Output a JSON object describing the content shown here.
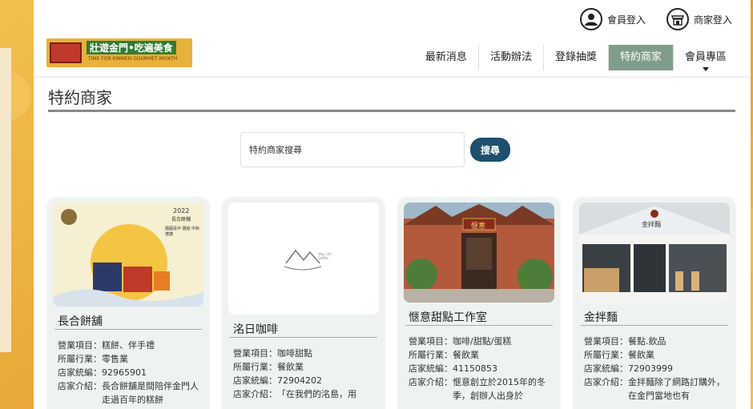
{
  "header": {
    "logo": {
      "title": "壯遊金門•吃遍美食",
      "subtitle": "TIME FOR KINMEN GOURMET MONTH"
    },
    "member_login": "會員登入",
    "merchant_login": "商家登入",
    "nav": [
      {
        "label": "最新消息"
      },
      {
        "label": "活動辦法"
      },
      {
        "label": "登錄抽獎"
      },
      {
        "label": "特約商家"
      },
      {
        "label": "會員專區"
      }
    ]
  },
  "page_title": "特約商家",
  "search": {
    "placeholder": "特約商家搜尋",
    "button": "搜尋"
  },
  "cards": [
    {
      "name": "長合餅舖",
      "img_year": "2022",
      "img_brand": "長合餅舖",
      "img_text": "團圓喜中 團結 中秋禮讚",
      "rows": [
        {
          "k": "營業項目：",
          "v": "糕餅、伴手禮"
        },
        {
          "k": "所屬行業：",
          "v": "零售業"
        },
        {
          "k": "店家統編：",
          "v": "92965901"
        },
        {
          "k": "店家介紹：",
          "v": "長合餅舖是間陪伴金門人走過百年的糕餅"
        }
      ]
    },
    {
      "name": "洺日咖啡",
      "logo_text": "Way Life Coffee",
      "rows": [
        {
          "k": "營業項目：",
          "v": "咖啡甜點"
        },
        {
          "k": "所屬行業：",
          "v": "餐飲業"
        },
        {
          "k": "店家統編：",
          "v": "72904202"
        },
        {
          "k": "店家介紹：",
          "v": "「在我們的洺島，用"
        }
      ]
    },
    {
      "name": "愜意甜點工作室",
      "sign": "愜意",
      "rows": [
        {
          "k": "營業項目：",
          "v": "咖啡/甜點/蛋糕"
        },
        {
          "k": "所屬行業：",
          "v": "餐飲業"
        },
        {
          "k": "店家統編：",
          "v": "41150853"
        },
        {
          "k": "店家介紹：",
          "v": "愜意創立於2015年的冬季，創辦人出身於"
        }
      ]
    },
    {
      "name": "金拌麵",
      "sign": "金拌麵",
      "rows": [
        {
          "k": "營業項目：",
          "v": "餐點.飲品"
        },
        {
          "k": "所屬行業：",
          "v": "餐飲業"
        },
        {
          "k": "店家統編：",
          "v": "72903999"
        },
        {
          "k": "店家介紹：",
          "v": "金拌麵除了網路訂購外，在金門當地也有"
        }
      ]
    }
  ],
  "colors": {
    "nav_active": "#7f9e8a",
    "search_button": "#1e4f6e",
    "card_bg": "#eef3f1"
  }
}
